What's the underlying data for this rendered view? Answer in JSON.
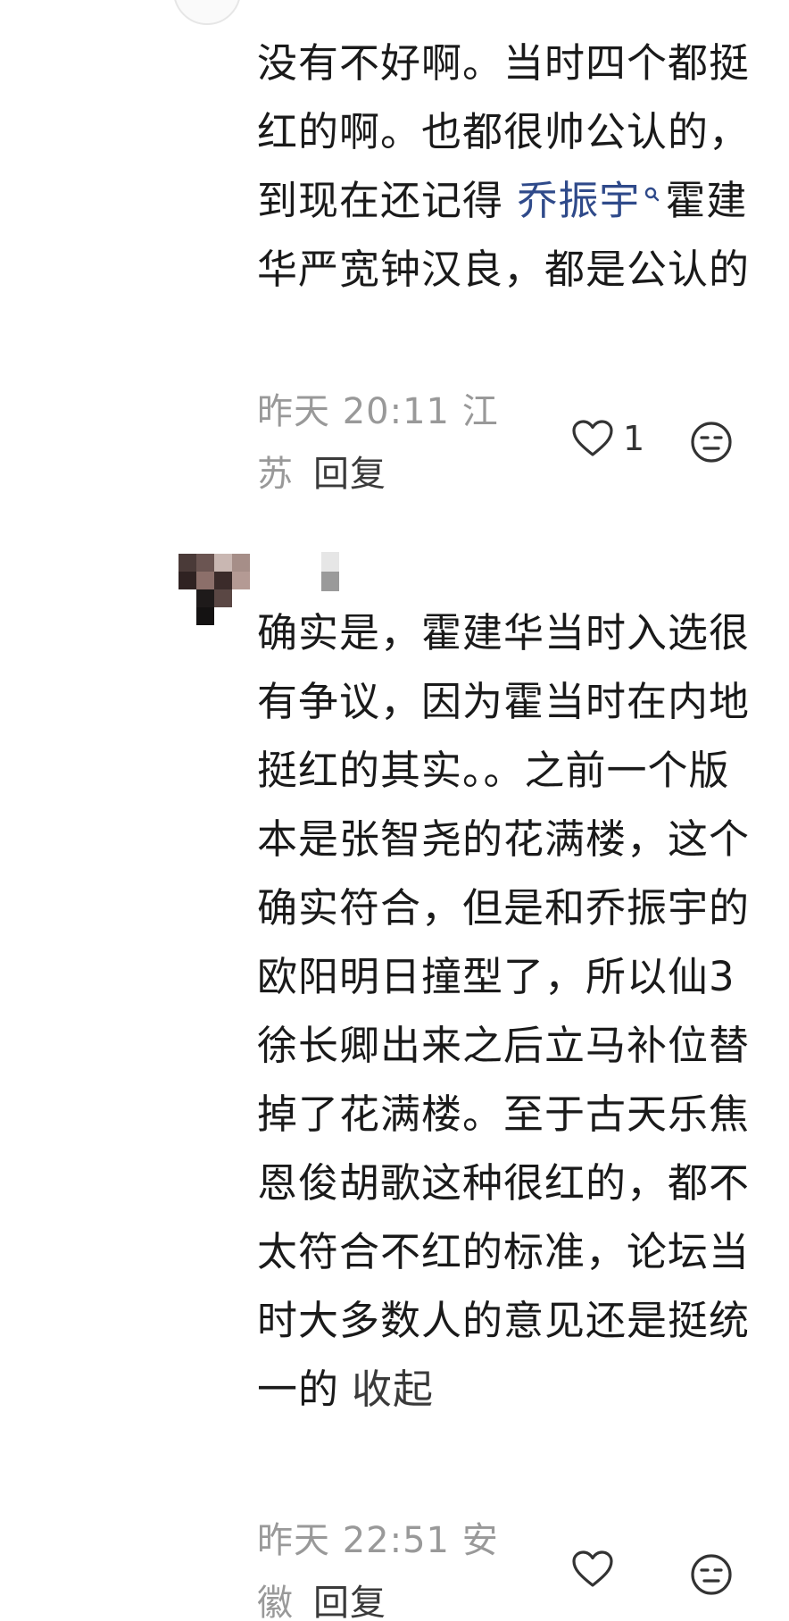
{
  "comments": [
    {
      "body_before": "没有不好啊。当时四个都挺红的啊。也都很帅公认的，到现在还记得",
      "keyword": "乔振宇",
      "body_after": "霍建华严宽钟汉良，都是公认的",
      "time": "昨天 20:11",
      "location": "江苏",
      "reply_label": "回复",
      "like_count": "1"
    },
    {
      "body": "确实是，霍建华当时入选很有争议，因为霍当时在内地挺红的其实。。之前一个版本是张智尧的花满楼，这个确实符合，但是和乔振宇的欧阳明日撞型了，所以仙3徐长卿出来之后立马补位替掉了花满楼。至于古天乐焦恩俊胡歌这种很红的，都不太符合不红的标准，论坛当时大多数人的意见还是挺统一的",
      "collapse_label": "收起",
      "time": "昨天 22:51",
      "location": "安徽",
      "reply_label": "回复",
      "like_count": ""
    }
  ],
  "icons": {
    "like": "heart-outline-icon",
    "emoji": "neutral-face-icon",
    "keyword_search": "search-icon"
  },
  "colors": {
    "text": "#1a1a1a",
    "meta": "#999999",
    "keyword_link": "#2f4a8a",
    "action": "#3a3a3a"
  }
}
